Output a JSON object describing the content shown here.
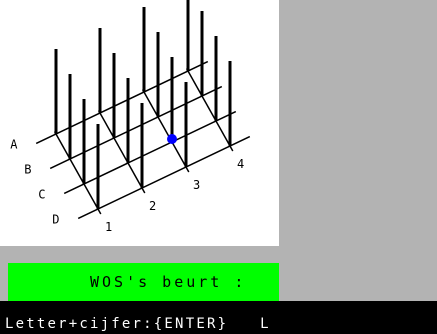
{
  "board": {
    "row_labels": [
      "A",
      "B",
      "C",
      "D"
    ],
    "column_labels": [
      "1",
      "2",
      "3",
      "4"
    ],
    "pegs_per_side": 4,
    "placed_pieces": [
      {
        "row": "C",
        "column": "3",
        "color": "#0000ff"
      }
    ]
  },
  "status": {
    "text": "WOS's beurt :"
  },
  "input": {
    "prompt": "Letter+cijfer:{ENTER}",
    "value": "L"
  },
  "colors": {
    "board_background": "#ffffff",
    "page_background": "#b3b3b3",
    "status_background": "#00ff00",
    "input_background": "#000000",
    "input_text": "#ffffff",
    "piece_blue": "#0000ff"
  }
}
